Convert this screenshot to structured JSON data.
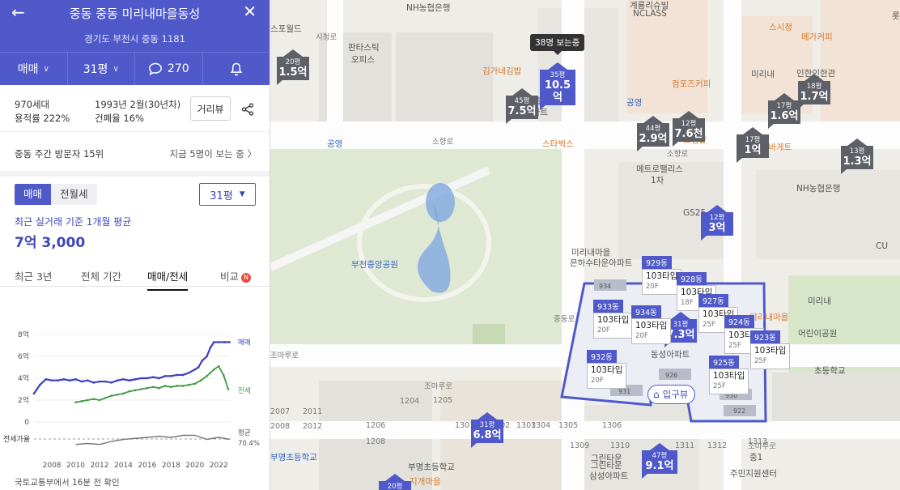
{
  "header": {
    "title": "중동 중동 미리내마을동성",
    "address": "경기도 부천시 중동 1181",
    "deal_type": "매매",
    "size": "31평",
    "comments": "270"
  },
  "stats": {
    "households": "970세대",
    "floor_area_ratio": "용적률 222%",
    "built": "1993년 2월(30년차)",
    "coverage_ratio": "건폐율 16%",
    "view_button": "거리뷰"
  },
  "rank": {
    "left": "중동 주간 방문자 15위",
    "right": "지금 5명이 보는 중 〉"
  },
  "price": {
    "seg_sale": "매매",
    "seg_rent": "전월세",
    "size_select": "31평",
    "recent_label": "최근 실거래 기준 1개월 평균",
    "recent_value": "7억 3,000"
  },
  "tabs": [
    "최근 3년",
    "전체 기간",
    "매매/전세",
    "비교"
  ],
  "tab_badge": "N",
  "footnote": "국토교통부에서 16분 전 확인",
  "chart_data": {
    "type": "line",
    "y_ticks": [
      "8억",
      "6억",
      "4억",
      "2억",
      "0"
    ],
    "ylim": [
      0,
      8
    ],
    "x_ticks": [
      "2008",
      "2010",
      "2012",
      "2014",
      "2016",
      "2018",
      "2020",
      "2022"
    ],
    "xlim": [
      2006.5,
      2023
    ],
    "series": [
      {
        "name": "매매",
        "color": "#3b3fc4",
        "x": [
          2006.5,
          2007,
          2007.5,
          2008,
          2008.5,
          2009,
          2009.5,
          2010,
          2010.5,
          2011,
          2011.5,
          2012,
          2012.5,
          2013,
          2013.5,
          2014,
          2014.5,
          2015,
          2015.5,
          2016,
          2016.5,
          2017,
          2017.5,
          2018,
          2018.5,
          2019,
          2019.5,
          2020,
          2020.3,
          2020.6,
          2021,
          2021.3,
          2021.6,
          2022,
          2022.5,
          2022.9
        ],
        "values": [
          2.6,
          3.4,
          3.9,
          3.8,
          3.8,
          3.9,
          3.8,
          3.9,
          3.7,
          3.8,
          3.6,
          3.7,
          3.7,
          3.6,
          3.8,
          3.9,
          3.8,
          3.9,
          4.0,
          4.0,
          4.1,
          4.0,
          4.2,
          4.2,
          4.3,
          4.3,
          4.5,
          4.8,
          5.0,
          5.6,
          6.0,
          6.8,
          7.3,
          7.3,
          7.3,
          7.3
        ]
      },
      {
        "name": "전세",
        "color": "#3f9a42",
        "x": [
          2010,
          2010.5,
          2011,
          2011.5,
          2012,
          2012.5,
          2013,
          2013.5,
          2014,
          2014.5,
          2015,
          2015.5,
          2016,
          2016.5,
          2017,
          2017.5,
          2018,
          2018.5,
          2019,
          2019.5,
          2020,
          2020.5,
          2021,
          2021.3,
          2021.6,
          2022,
          2022.4,
          2022.8
        ],
        "values": [
          1.8,
          1.9,
          2.0,
          2.1,
          2.0,
          2.2,
          2.4,
          2.5,
          2.6,
          2.8,
          2.9,
          3.0,
          3.1,
          3.2,
          3.1,
          3.3,
          3.2,
          3.3,
          3.3,
          3.4,
          3.5,
          3.8,
          4.2,
          4.5,
          4.8,
          5.1,
          4.3,
          3.0
        ]
      },
      {
        "name": "전세가율",
        "color": "#777777",
        "x": [
          2010,
          2011,
          2012,
          2013,
          2014,
          2015,
          2016,
          2017,
          2018,
          2019,
          2020,
          2021,
          2022,
          2022.9
        ],
        "values": [
          0.6,
          0.62,
          0.6,
          0.66,
          0.7,
          0.72,
          0.74,
          0.76,
          0.74,
          0.78,
          0.78,
          0.7,
          0.74,
          0.7
        ]
      }
    ],
    "legend": [
      "매매",
      "전세"
    ],
    "ratio_label": "전세가율",
    "ratio_legend": "평균",
    "ratio_value": "70.4%"
  },
  "map": {
    "tooltip": "38명 보는중",
    "entrance": "입구뷰",
    "place_labels": [
      {
        "text": "NH농협은행",
        "cls": ""
      },
      {
        "text": "계룡리슈빌",
        "cls": ""
      },
      {
        "text": "NCLASS",
        "cls": ""
      },
      {
        "text": "스포월드",
        "cls": ""
      },
      {
        "text": "판타스틱",
        "cls": ""
      },
      {
        "text": "오피스",
        "cls": ""
      },
      {
        "text": "김가네김밥",
        "cls": "orange"
      },
      {
        "text": "센트럴파크",
        "cls": ""
      },
      {
        "text": "아파트",
        "cls": ""
      },
      {
        "text": "컴포즈커피",
        "cls": "orange"
      },
      {
        "text": "공영",
        "cls": "blue"
      },
      {
        "text": "공영",
        "cls": "blue"
      },
      {
        "text": "스타벅스",
        "cls": "orange"
      },
      {
        "text": "소향로",
        "cls": "sm"
      },
      {
        "text": "소향로",
        "cls": "sm"
      },
      {
        "text": "메트로팰리스",
        "cls": ""
      },
      {
        "text": "1차",
        "cls": ""
      },
      {
        "text": "드림할",
        "cls": "orange"
      },
      {
        "text": "파리바게트",
        "cls": "orange"
      },
      {
        "text": "NH농협은행",
        "cls": ""
      },
      {
        "text": "스시정",
        "cls": "orange"
      },
      {
        "text": "메가커피",
        "cls": "orange"
      },
      {
        "text": "미리내",
        "cls": ""
      },
      {
        "text": "인한인한관",
        "cls": ""
      },
      {
        "text": "롯데시",
        "cls": ""
      },
      {
        "text": "GS25",
        "cls": ""
      },
      {
        "text": "부천중앙공원",
        "cls": "blue"
      },
      {
        "text": "미리내마을",
        "cls": ""
      },
      {
        "text": "은하수타운아파트",
        "cls": ""
      },
      {
        "text": "동성아파트",
        "cls": ""
      },
      {
        "text": "미리내마을",
        "cls": "orange"
      },
      {
        "text": "미리내",
        "cls": ""
      },
      {
        "text": "어린이공원",
        "cls": ""
      },
      {
        "text": "초등학교",
        "cls": ""
      },
      {
        "text": "조마루로",
        "cls": "sm"
      },
      {
        "text": "조마루로",
        "cls": "sm"
      },
      {
        "text": "조마루로",
        "cls": "sm"
      },
      {
        "text": "부명초등학교",
        "cls": "blue"
      },
      {
        "text": "부명초등학교",
        "cls": ""
      },
      {
        "text": "그린타운",
        "cls": ""
      },
      {
        "text": "삼성아파트",
        "cls": ""
      },
      {
        "text": "중1",
        "cls": ""
      },
      {
        "text": "주민지원센터",
        "cls": ""
      },
      {
        "text": "CU",
        "cls": ""
      },
      {
        "text": "지개마을",
        "cls": "orange"
      },
      {
        "text": "그린타운",
        "cls": ""
      },
      {
        "text": "중동로",
        "cls": "sm"
      },
      {
        "text": "시청로",
        "cls": "sm"
      },
      {
        "text": "1205",
        "cls": "sm"
      },
      {
        "text": "1204",
        "cls": "sm"
      },
      {
        "text": "1302",
        "cls": "sm"
      },
      {
        "text": "1303",
        "cls": "sm"
      },
      {
        "text": "1304",
        "cls": "sm"
      },
      {
        "text": "1305",
        "cls": "sm"
      },
      {
        "text": "1306",
        "cls": "sm"
      },
      {
        "text": "1309",
        "cls": "sm"
      },
      {
        "text": "1310",
        "cls": "sm"
      },
      {
        "text": "1311",
        "cls": "sm"
      },
      {
        "text": "1312",
        "cls": "sm"
      },
      {
        "text": "1313",
        "cls": "sm"
      },
      {
        "text": "1301",
        "cls": "sm"
      },
      {
        "text": "1206",
        "cls": "sm"
      },
      {
        "text": "1208",
        "cls": "sm"
      },
      {
        "text": "2007",
        "cls": "sm"
      },
      {
        "text": "2008",
        "cls": "sm"
      },
      {
        "text": "2011",
        "cls": "sm"
      },
      {
        "text": "2012",
        "cls": "sm"
      }
    ],
    "price_markers": [
      {
        "size": "20평",
        "price": "1.5억",
        "color": "gray"
      },
      {
        "size": "35평",
        "price": "10.5억",
        "color": "blue"
      },
      {
        "size": "45평",
        "price": "7.5억",
        "color": "gray"
      },
      {
        "size": "44평",
        "price": "2.9억",
        "color": "gray"
      },
      {
        "size": "12평",
        "price": "7.6천",
        "color": "gray"
      },
      {
        "size": "17평",
        "price": "1.6억",
        "color": "gray"
      },
      {
        "size": "18평",
        "price": "1.7억",
        "color": "gray"
      },
      {
        "size": "17평",
        "price": "1억",
        "color": "gray"
      },
      {
        "size": "13평",
        "price": "1.3억",
        "color": "gray"
      },
      {
        "size": "12평",
        "price": "3억",
        "color": "blue"
      },
      {
        "size": "31평",
        "price": "7.3억",
        "color": "blue"
      },
      {
        "size": "31평",
        "price": "6.8억",
        "color": "blue"
      },
      {
        "size": "47평",
        "price": "9.1억",
        "color": "blue"
      },
      {
        "size": "20평",
        "price": "",
        "color": "blue"
      }
    ],
    "dongs": [
      {
        "name": "929동",
        "type": "103타입",
        "floor": "20F"
      },
      {
        "name": "928동",
        "type": "103타입",
        "floor": "18F"
      },
      {
        "name": "933동",
        "type": "103타입",
        "floor": "20F"
      },
      {
        "name": "934동",
        "type": "103타입",
        "floor": "20F"
      },
      {
        "name": "927동",
        "type": "103타입",
        "floor": "25F"
      },
      {
        "name": "924동",
        "type": "103타입",
        "floor": "25F"
      },
      {
        "name": "923동",
        "type": "103타입",
        "floor": "25F"
      },
      {
        "name": "932동",
        "type": "103타입",
        "floor": "20F"
      },
      {
        "name": "925동",
        "type": "103타입",
        "floor": "25F"
      }
    ],
    "building_numbers": [
      "934",
      "931",
      "926",
      "922",
      "930"
    ]
  },
  "colors": {
    "brand": "#5059c9",
    "gray_marker": "#5d6167",
    "park": "#dfe8d2"
  }
}
